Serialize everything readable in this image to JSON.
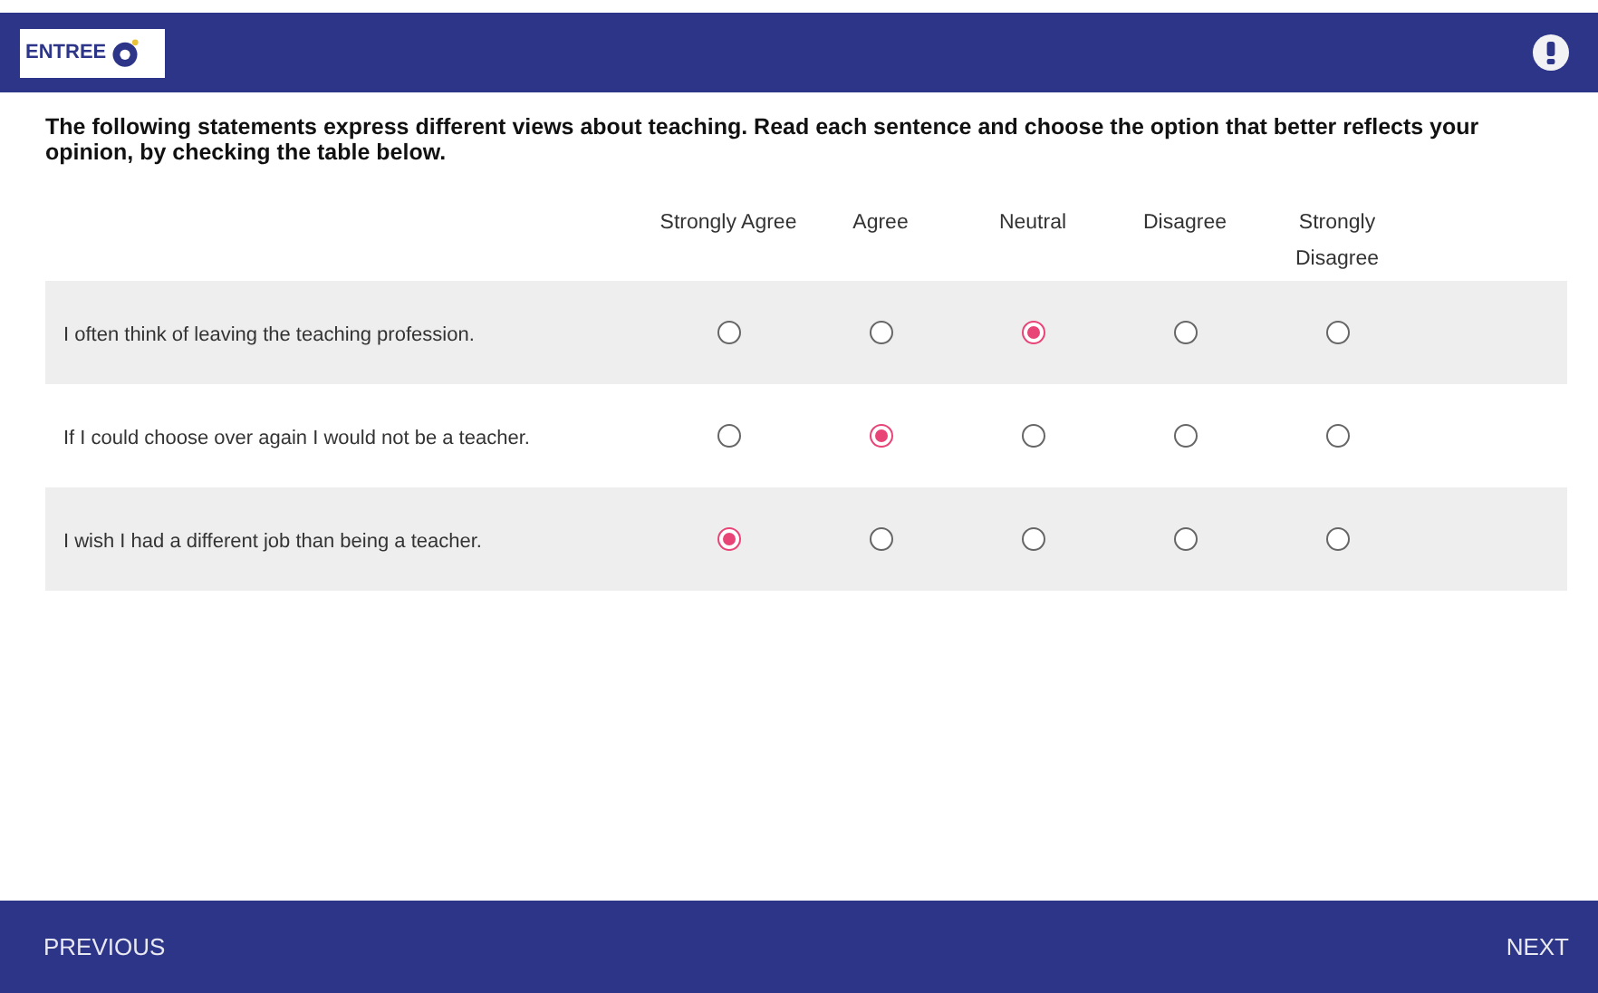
{
  "header": {
    "logo": "ENTREE"
  },
  "intro": "The following statements express different views about teaching. Read each sentence and choose the option that better reflects your opinion, by checking the table below.",
  "columns": [
    "Strongly Agree",
    "Agree",
    "Neutral",
    "Disagree",
    "Strongly Disagree"
  ],
  "rows": [
    {
      "statement": "I often think of leaving the teaching profession.",
      "options": [
        {
          "selected": false
        },
        {
          "selected": false
        },
        {
          "selected": true
        },
        {
          "selected": false
        },
        {
          "selected": false
        }
      ]
    },
    {
      "statement": "If I could choose over again I would not be a teacher.",
      "options": [
        {
          "selected": false
        },
        {
          "selected": true
        },
        {
          "selected": false
        },
        {
          "selected": false
        },
        {
          "selected": false
        }
      ]
    },
    {
      "statement": "I wish I had a different job than being a teacher.",
      "options": [
        {
          "selected": true
        },
        {
          "selected": false
        },
        {
          "selected": false
        },
        {
          "selected": false
        },
        {
          "selected": false
        }
      ]
    }
  ],
  "footer": {
    "previous": "PREVIOUS",
    "next": "NEXT"
  }
}
